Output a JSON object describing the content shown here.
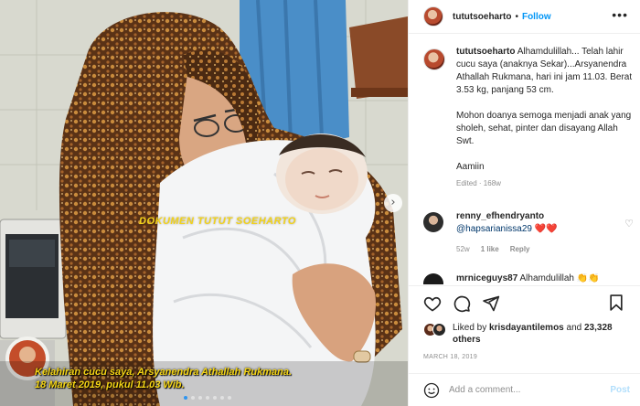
{
  "photo": {
    "watermark": "DOKUMEN TUTUT SOEHARTO",
    "caption_line1": "Kelahiran cucu saya, Arsyanendra Athallah Rukmana.",
    "caption_line2": "18 Maret 2019,  pukul 11.03 Wib.",
    "carousel_next": "›",
    "dot_count": 7,
    "active_dot": 0
  },
  "header": {
    "username": "tututsoeharto",
    "separator": "•",
    "follow_label": "Follow",
    "more_label": "•••"
  },
  "post": {
    "username": "tututsoeharto",
    "caption_p1": "Alhamdulillah... Telah lahir cucu saya (anaknya Sekar)...Arsyanendra Athallah Rukmana, hari ini jam 11.03. Berat 3.53 kg, panjang 53 cm.",
    "caption_p2": "Mohon doanya semoga menjadi anak yang sholeh, sehat, pinter dan disayang Allah Swt.",
    "caption_p3": "Aamiin",
    "edited": "Edited · 168w"
  },
  "comments": [
    {
      "username": "renny_efhendryanto",
      "mention": "@hapsarianissa29",
      "hearts": "❤️❤️",
      "age": "52w",
      "likes": "1 like",
      "reply": "Reply"
    },
    {
      "username": "mrniceguys87",
      "text": "Alhamdulillah",
      "emoji": "👏👏"
    }
  ],
  "likes": {
    "liked_by": "Liked by",
    "user": "krisdayantilemos",
    "and": "and",
    "others": "23,328 others"
  },
  "date": "MARCH 18, 2019",
  "add_comment": {
    "placeholder": "Add a comment...",
    "post_label": "Post"
  },
  "colors": {
    "accent": "#0095f6",
    "caption_yellow": "#f5d515",
    "heart_red": "#ed1c24"
  }
}
